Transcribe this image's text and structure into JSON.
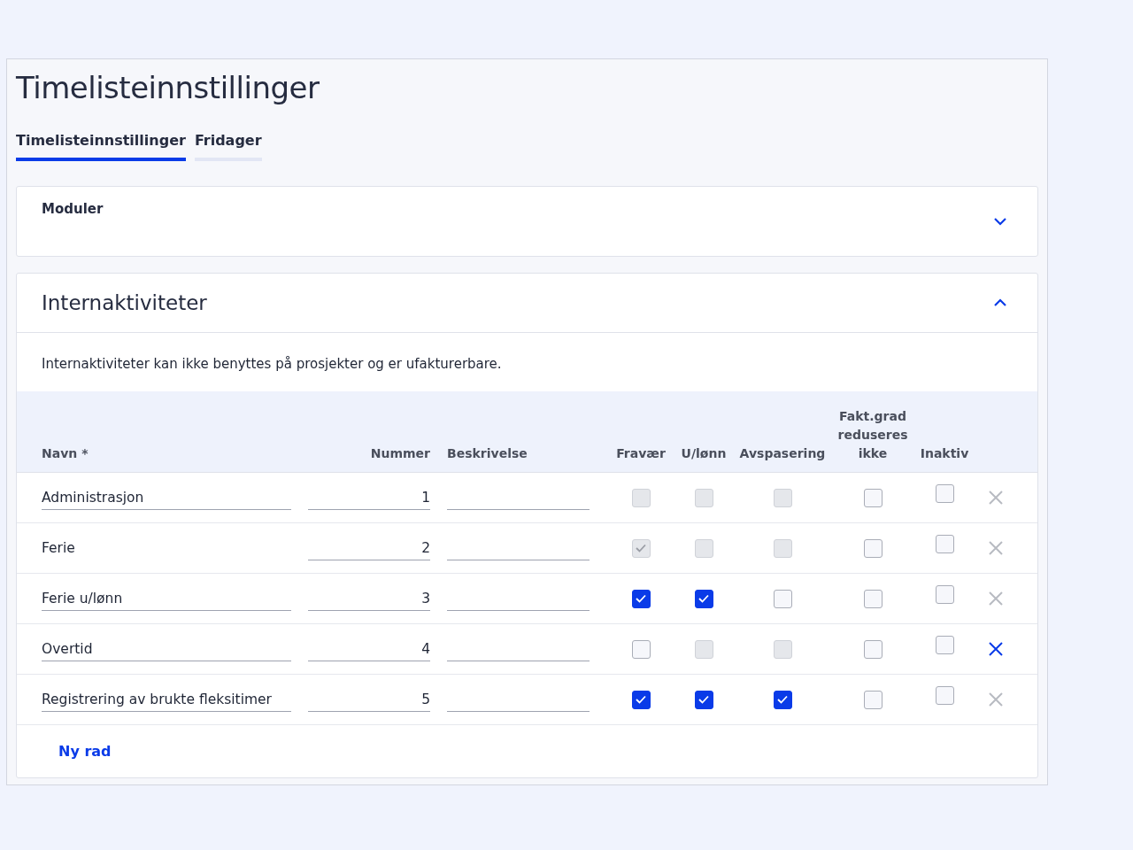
{
  "page_title": "Timelisteinnstillinger",
  "tabs": [
    {
      "label": "Timelisteinnstillinger",
      "selected": true
    },
    {
      "label": "Fridager",
      "selected": false
    }
  ],
  "sections": [
    {
      "title": "Moduler",
      "expanded": false
    },
    {
      "title": "Internaktiviteter",
      "expanded": true,
      "description": "Internaktiviteter kan ikke benyttes på prosjekter og er ufakturerbare.",
      "table": {
        "columns": [
          "Navn *",
          "Nummer",
          "Beskrivelse",
          "Fravær",
          "U/lønn",
          "Avspasering",
          "Fakt.grad reduseres ikke",
          "Inaktiv"
        ],
        "rows": [
          {
            "name": "Administrasjon",
            "name_editable": true,
            "number": "1",
            "checks": [
              {
                "checked": false,
                "disabled": true
              },
              {
                "checked": false,
                "disabled": true
              },
              {
                "checked": false,
                "disabled": true
              },
              {
                "checked": false,
                "disabled": false
              },
              {
                "checked": false,
                "disabled": false
              }
            ],
            "delete_highlighted": false
          },
          {
            "name": "Ferie",
            "name_editable": false,
            "number": "2",
            "checks": [
              {
                "checked": true,
                "disabled": true
              },
              {
                "checked": false,
                "disabled": true
              },
              {
                "checked": false,
                "disabled": true
              },
              {
                "checked": false,
                "disabled": false
              },
              {
                "checked": false,
                "disabled": false
              }
            ],
            "delete_highlighted": false
          },
          {
            "name": "Ferie u/lønn",
            "name_editable": true,
            "number": "3",
            "checks": [
              {
                "checked": true,
                "disabled": false
              },
              {
                "checked": true,
                "disabled": false
              },
              {
                "checked": false,
                "disabled": false
              },
              {
                "checked": false,
                "disabled": false
              },
              {
                "checked": false,
                "disabled": false
              }
            ],
            "delete_highlighted": false
          },
          {
            "name": "Overtid",
            "name_editable": true,
            "number": "4",
            "checks": [
              {
                "checked": false,
                "disabled": false
              },
              {
                "checked": false,
                "disabled": true
              },
              {
                "checked": false,
                "disabled": true
              },
              {
                "checked": false,
                "disabled": false
              },
              {
                "checked": false,
                "disabled": false
              }
            ],
            "delete_highlighted": true
          },
          {
            "name": "Registrering av brukte fleksitimer",
            "name_editable": true,
            "number": "5",
            "checks": [
              {
                "checked": true,
                "disabled": false
              },
              {
                "checked": true,
                "disabled": false
              },
              {
                "checked": true,
                "disabled": false
              },
              {
                "checked": false,
                "disabled": false
              },
              {
                "checked": false,
                "disabled": false
              }
            ],
            "delete_highlighted": false
          }
        ]
      },
      "add_row_label": "Ny rad"
    }
  ]
}
